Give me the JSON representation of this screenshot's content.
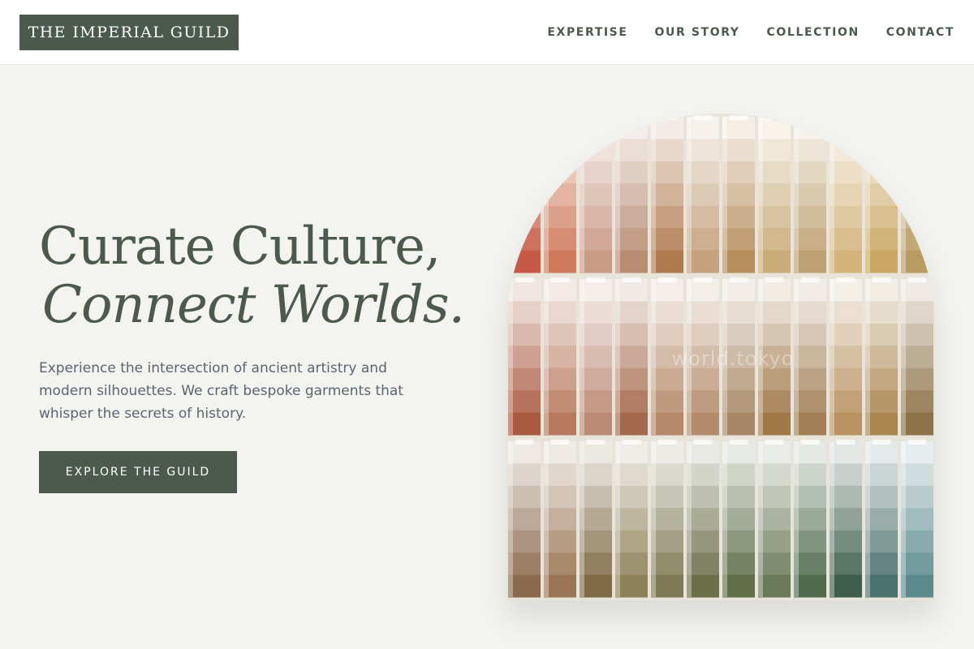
{
  "header": {
    "logo_text": "THE IMPERIAL GUILD",
    "nav": [
      {
        "label": "EXPERTISE"
      },
      {
        "label": "OUR STORY"
      },
      {
        "label": "COLLECTION"
      },
      {
        "label": "CONTACT"
      }
    ]
  },
  "hero": {
    "headline_line1": "Curate Culture,",
    "headline_line2": "Connect Worlds.",
    "description": "Experience the intersection of ancient artistry and modern silhouettes. We craft bespoke garments that whisper the secrets of history.",
    "cta_label": "EXPLORE THE GUILD",
    "image": {
      "subject": "paint swatch card display",
      "watermark": "world.tokyo",
      "rows": [
        [
          "#c85a45",
          "#d07a5c",
          "#c99a86",
          "#b88d73",
          "#b07a4f",
          "#c4a27d",
          "#b78f5d",
          "#c9ac7a",
          "#bfa273",
          "#d3b57c",
          "#c9a863",
          "#b89a63"
        ],
        [
          "#a95a3f",
          "#b87a5e",
          "#bb8a74",
          "#a4694c",
          "#b6896a",
          "#b38c6c",
          "#a88766",
          "#a07848",
          "#a27f55",
          "#b8925f",
          "#a9864f",
          "#8d7147"
        ],
        [
          "#8b6a4e",
          "#9b7654",
          "#7f6a45",
          "#8e8158",
          "#7e7a55",
          "#6c6e4a",
          "#5f6e48",
          "#6b7a58",
          "#4f6b4e",
          "#3f5f4c",
          "#4c706c",
          "#5b8a8e"
        ]
      ],
      "colors": {
        "accent": "#4b5a4c",
        "background": "#f3f4ef",
        "header": "#ffffff"
      }
    }
  }
}
